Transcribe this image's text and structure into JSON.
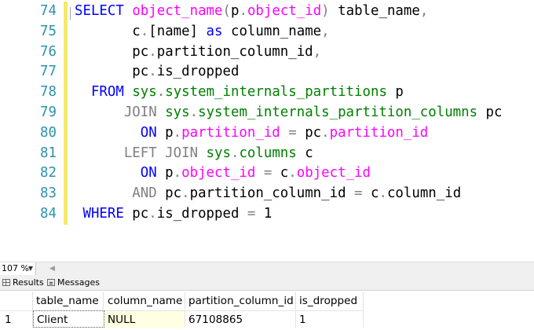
{
  "editor": {
    "lines": [
      {
        "n": "74",
        "tokens": [
          {
            "t": "SELECT",
            "c": "kw"
          },
          {
            "t": " ",
            "c": "plain"
          },
          {
            "t": "object_name",
            "c": "fn"
          },
          {
            "t": "(",
            "c": "gray"
          },
          {
            "t": "p",
            "c": "plain"
          },
          {
            "t": ".",
            "c": "gray"
          },
          {
            "t": "object_id",
            "c": "fn"
          },
          {
            "t": ")",
            "c": "gray"
          },
          {
            "t": " table_name",
            "c": "plain"
          },
          {
            "t": ",",
            "c": "gray"
          }
        ]
      },
      {
        "n": "75",
        "tokens": [
          {
            "t": "       c",
            "c": "plain"
          },
          {
            "t": ".",
            "c": "gray"
          },
          {
            "t": "[name] ",
            "c": "plain"
          },
          {
            "t": "as",
            "c": "kw"
          },
          {
            "t": " column_name",
            "c": "plain"
          },
          {
            "t": ",",
            "c": "gray"
          }
        ]
      },
      {
        "n": "76",
        "tokens": [
          {
            "t": "       pc",
            "c": "plain"
          },
          {
            "t": ".",
            "c": "gray"
          },
          {
            "t": "partition_column_id",
            "c": "plain"
          },
          {
            "t": ",",
            "c": "gray"
          }
        ]
      },
      {
        "n": "77",
        "tokens": [
          {
            "t": "       pc",
            "c": "plain"
          },
          {
            "t": ".",
            "c": "gray"
          },
          {
            "t": "is_dropped",
            "c": "plain"
          }
        ]
      },
      {
        "n": "78",
        "tokens": [
          {
            "t": "  FROM",
            "c": "kw"
          },
          {
            "t": " ",
            "c": "plain"
          },
          {
            "t": "sys",
            "c": "sys"
          },
          {
            "t": ".",
            "c": "gray"
          },
          {
            "t": "system_internals_partitions",
            "c": "sys"
          },
          {
            "t": " p",
            "c": "plain"
          }
        ]
      },
      {
        "n": "79",
        "tokens": [
          {
            "t": "      JOIN",
            "c": "gray"
          },
          {
            "t": " ",
            "c": "plain"
          },
          {
            "t": "sys",
            "c": "sys"
          },
          {
            "t": ".",
            "c": "gray"
          },
          {
            "t": "system_internals_partition_columns",
            "c": "sys"
          },
          {
            "t": " pc",
            "c": "plain"
          }
        ]
      },
      {
        "n": "80",
        "tokens": [
          {
            "t": "        ON",
            "c": "kw"
          },
          {
            "t": " p",
            "c": "plain"
          },
          {
            "t": ".",
            "c": "gray"
          },
          {
            "t": "partition_id",
            "c": "fn"
          },
          {
            "t": " = ",
            "c": "gray"
          },
          {
            "t": "pc",
            "c": "plain"
          },
          {
            "t": ".",
            "c": "gray"
          },
          {
            "t": "partition_id",
            "c": "fn"
          }
        ]
      },
      {
        "n": "81",
        "tokens": [
          {
            "t": "      LEFT JOIN",
            "c": "gray"
          },
          {
            "t": " ",
            "c": "plain"
          },
          {
            "t": "sys",
            "c": "sys"
          },
          {
            "t": ".",
            "c": "gray"
          },
          {
            "t": "columns",
            "c": "sys"
          },
          {
            "t": " c",
            "c": "plain"
          }
        ]
      },
      {
        "n": "82",
        "tokens": [
          {
            "t": "        ON",
            "c": "kw"
          },
          {
            "t": " p",
            "c": "plain"
          },
          {
            "t": ".",
            "c": "gray"
          },
          {
            "t": "object_id",
            "c": "fn"
          },
          {
            "t": " = ",
            "c": "gray"
          },
          {
            "t": "c",
            "c": "plain"
          },
          {
            "t": ".",
            "c": "gray"
          },
          {
            "t": "object_id",
            "c": "fn"
          }
        ]
      },
      {
        "n": "83",
        "tokens": [
          {
            "t": "       AND",
            "c": "gray"
          },
          {
            "t": " pc",
            "c": "plain"
          },
          {
            "t": ".",
            "c": "gray"
          },
          {
            "t": "partition_column_id",
            "c": "plain"
          },
          {
            "t": " = ",
            "c": "gray"
          },
          {
            "t": "c",
            "c": "plain"
          },
          {
            "t": ".",
            "c": "gray"
          },
          {
            "t": "column_id",
            "c": "plain"
          }
        ]
      },
      {
        "n": "84",
        "tokens": [
          {
            "t": " WHERE",
            "c": "kw"
          },
          {
            "t": " pc",
            "c": "plain"
          },
          {
            "t": ".",
            "c": "gray"
          },
          {
            "t": "is_dropped ",
            "c": "plain"
          },
          {
            "t": "=",
            "c": "gray"
          },
          {
            "t": " 1",
            "c": "plain"
          }
        ]
      }
    ],
    "colors": {
      "keyword": "#0000ff",
      "function": "#ff00ff",
      "system": "#008000",
      "operator": "#808080",
      "line_number": "#2b91af",
      "change_marker": "#f5e96a"
    }
  },
  "zoom": {
    "value": "107 %",
    "dropdown_icon": "chevron-down-icon",
    "scroll_icon": "scroll-left-icon"
  },
  "result_tabs": {
    "results": {
      "label": "Results",
      "icon": "grid-icon"
    },
    "messages": {
      "label": "Messages",
      "icon": "messages-icon"
    }
  },
  "grid": {
    "columns": [
      "table_name",
      "column_name",
      "partition_column_id",
      "is_dropped"
    ],
    "rows": [
      {
        "num": "1",
        "cells": [
          "Client",
          "NULL",
          "67108865",
          "1"
        ]
      }
    ],
    "null_cell_color": "#ffffe1"
  }
}
